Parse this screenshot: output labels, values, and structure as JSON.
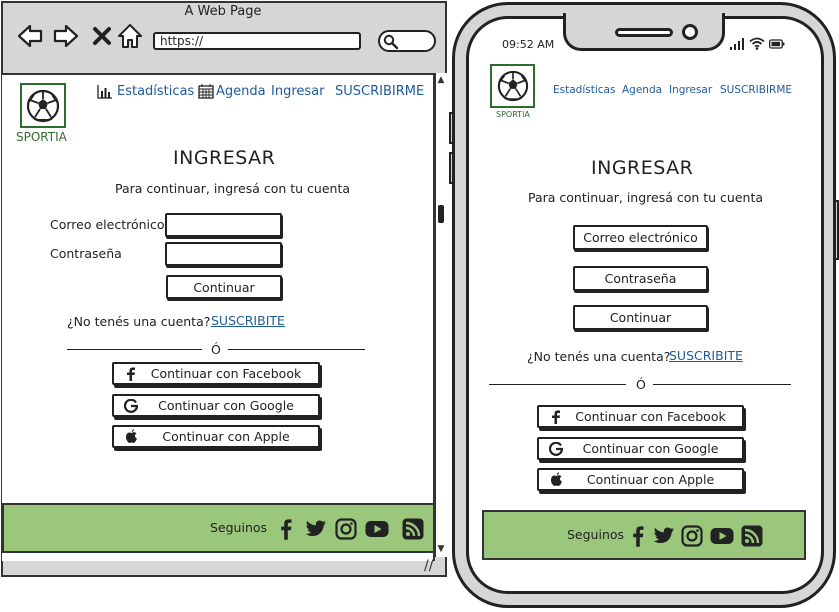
{
  "browser": {
    "window_title": "A Web Page",
    "url": "https://",
    "nav_icons": [
      "back-arrow-icon",
      "forward-arrow-icon",
      "close-x-icon",
      "home-icon"
    ]
  },
  "site": {
    "logo_text": "SPORTIA",
    "nav": {
      "stats": "Estadísticas",
      "agenda": "Agenda",
      "login": "Ingresar",
      "subscribe": "SUSCRIBIRME"
    },
    "login": {
      "title": "INGRESAR",
      "subtitle": "Para continuar, ingresá con tu cuenta",
      "email_label": "Correo electrónico",
      "password_label": "Contraseña",
      "continue": "Continuar",
      "no_account": "¿No tenés una cuenta?",
      "signup_link": "SUSCRIBITE",
      "divider": "Ó",
      "facebook": "Continuar con Facebook",
      "google": "Continuar con Google",
      "apple": "Continuar con Apple"
    },
    "footer": {
      "label": "Seguinos",
      "icons": [
        "facebook-icon",
        "twitter-icon",
        "instagram-icon",
        "youtube-icon",
        "rss-icon"
      ]
    }
  },
  "phone": {
    "time": "09:52 AM",
    "email_button": "Correo electrónico",
    "password_button": "Contraseña"
  },
  "colors": {
    "link": "#1f5a9c",
    "footer_bg": "#9bc77c",
    "logo": "#2f6b2f",
    "chrome": "#d6d6d6"
  }
}
